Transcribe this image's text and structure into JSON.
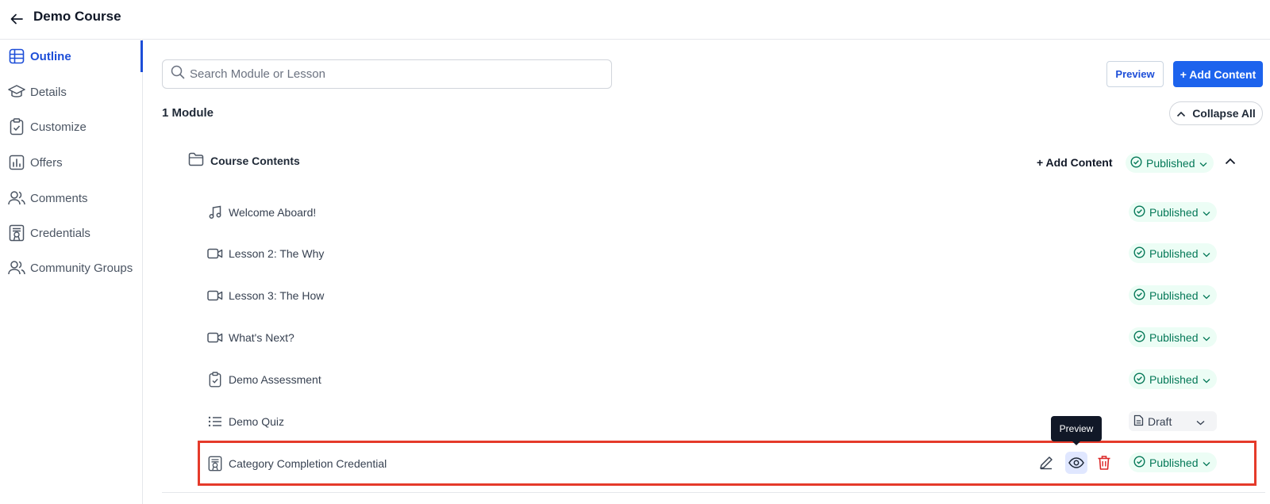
{
  "header": {
    "title": "Demo Course"
  },
  "sidebar": {
    "items": [
      {
        "label": "Outline",
        "icon": "outline-grid-icon",
        "active": true
      },
      {
        "label": "Details",
        "icon": "graduation-cap-icon"
      },
      {
        "label": "Customize",
        "icon": "clipboard-check-icon"
      },
      {
        "label": "Offers",
        "icon": "bar-chart-icon"
      },
      {
        "label": "Comments",
        "icon": "users-icon"
      },
      {
        "label": "Credentials",
        "icon": "certificate-icon"
      },
      {
        "label": "Community Groups",
        "icon": "users-icon"
      }
    ]
  },
  "search": {
    "placeholder": "Search Module or Lesson",
    "value": ""
  },
  "toolbar": {
    "preview_label": "Preview",
    "add_content_label": "+ Add Content"
  },
  "outline": {
    "module_count": "1 Module",
    "collapse_label": "Collapse All",
    "module": {
      "name": "Course Contents",
      "add_content_label": "+ Add Content",
      "status": "Published"
    },
    "lessons": [
      {
        "title": "Welcome Aboard!",
        "icon": "music-note-icon",
        "status": "Published"
      },
      {
        "title": "Lesson 2: The Why",
        "icon": "video-icon",
        "status": "Published"
      },
      {
        "title": "Lesson 3: The How",
        "icon": "video-icon",
        "status": "Published"
      },
      {
        "title": "What's Next?",
        "icon": "video-icon",
        "status": "Published"
      },
      {
        "title": "Demo Assessment",
        "icon": "clipboard-check-icon",
        "status": "Published"
      },
      {
        "title": "Demo Quiz",
        "icon": "list-icon",
        "status": "Draft"
      },
      {
        "title": "Category Completion Credential",
        "icon": "certificate-icon",
        "status": "Published"
      }
    ]
  },
  "tooltip": {
    "text": "Preview"
  },
  "colors": {
    "accent": "#1d63ed",
    "published_bg": "#ecfdf5",
    "published_text": "#047857",
    "highlight": "#e53a2a"
  }
}
